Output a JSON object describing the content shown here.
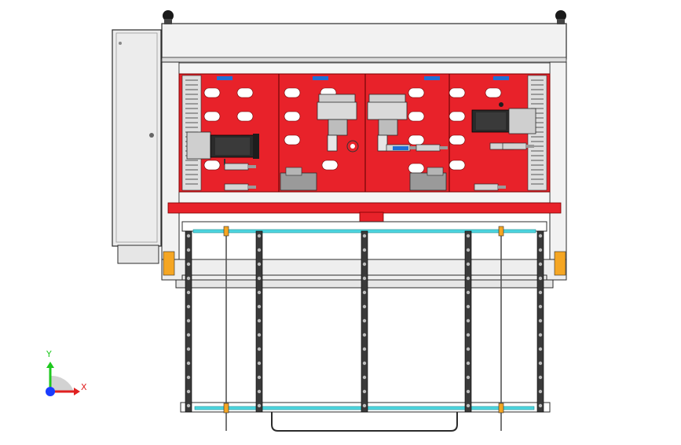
{
  "viewport": {
    "background": "#ffffff",
    "model": {
      "palette": {
        "mounting_plate": "#e8222a",
        "frame": "#f2f2f2",
        "frame_edge": "#2b2b2b",
        "cabinet": "#ececec",
        "guide_rail": "#4fd6e0",
        "motor_body": "#2a2a2a",
        "cylinder": "#c9c9c9",
        "bracket": "#777777",
        "accent_orange": "#f5a623",
        "plate_hole": "#ffffff"
      }
    },
    "triad": {
      "x_label": "X",
      "y_label": "Y",
      "x_color": "#e02020",
      "y_color": "#1ec81e",
      "z_color": "#1a3cff"
    }
  }
}
